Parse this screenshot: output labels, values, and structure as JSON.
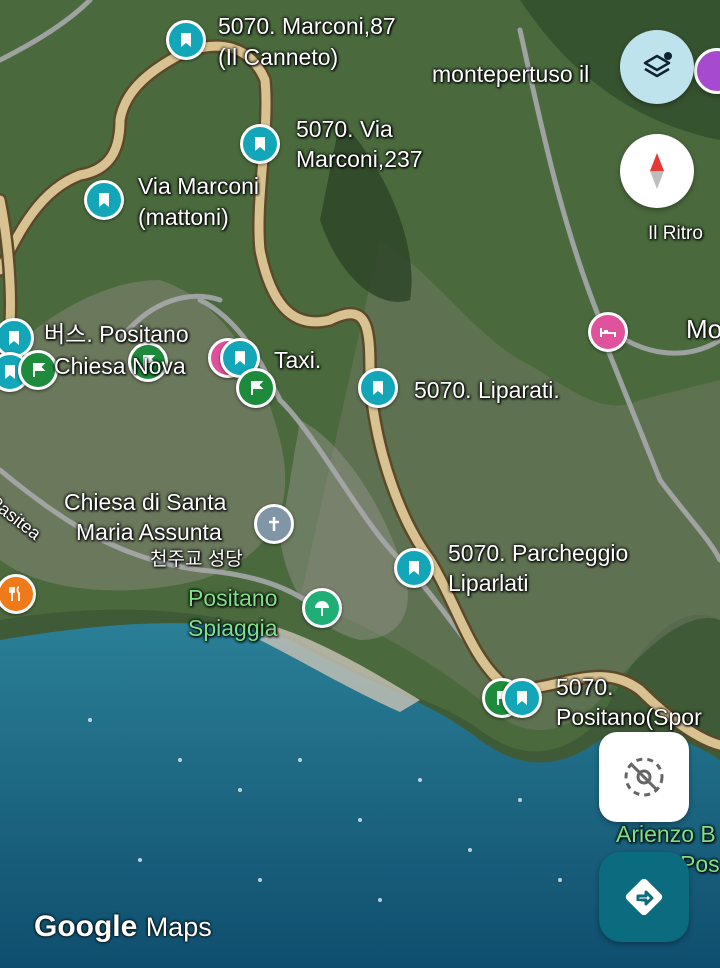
{
  "map": {
    "labels": {
      "marconi87_l1": "5070. Marconi,87",
      "marconi87_l2": "(Il Canneto)",
      "montepertuso": "montepertuso il",
      "via_marconi237_l1": "5070. Via",
      "via_marconi237_l2": "Marconi,237",
      "via_marconi_mattoni_l1": "Via Marconi",
      "via_marconi_mattoni_l2": "(mattoni)",
      "il_ritro": "Il Ritro",
      "mo": "Mo",
      "bus_positano": "버스. Positano",
      "chiesa_nova": "Chiesa Nova",
      "taxi": "Taxi.",
      "liparati": "5070. Liparati.",
      "chiesa_santa_l1": "Chiesa di Santa",
      "chiesa_santa_l2": "Maria Assunta",
      "chiesa_korean": "천주교 성당",
      "pasitea": "Pasitea",
      "parcheggio_l1": "5070. Parcheggio",
      "parcheggio_l2": "Liparlati",
      "spiaggia_l1": "Positano",
      "spiaggia_l2": "Spiaggia",
      "positano_sport_l1": "5070.",
      "positano_sport_l2": "Positano(Spor",
      "arienzo_l1": "Arienzo B",
      "arienzo_l2": "Pos"
    },
    "logo": {
      "google": "Google",
      "maps": "Maps"
    }
  },
  "controls": {
    "layers_icon": "layers-icon",
    "compass_icon": "compass-icon",
    "recenter_icon": "recenter-icon",
    "directions_icon": "directions-icon"
  },
  "colors": {
    "pin_teal": "#13a6b8",
    "pin_green": "#1e8a3c",
    "route_tan": "#d9c291",
    "sea": "#1a6a86",
    "directions_btn": "#0b6c80"
  }
}
